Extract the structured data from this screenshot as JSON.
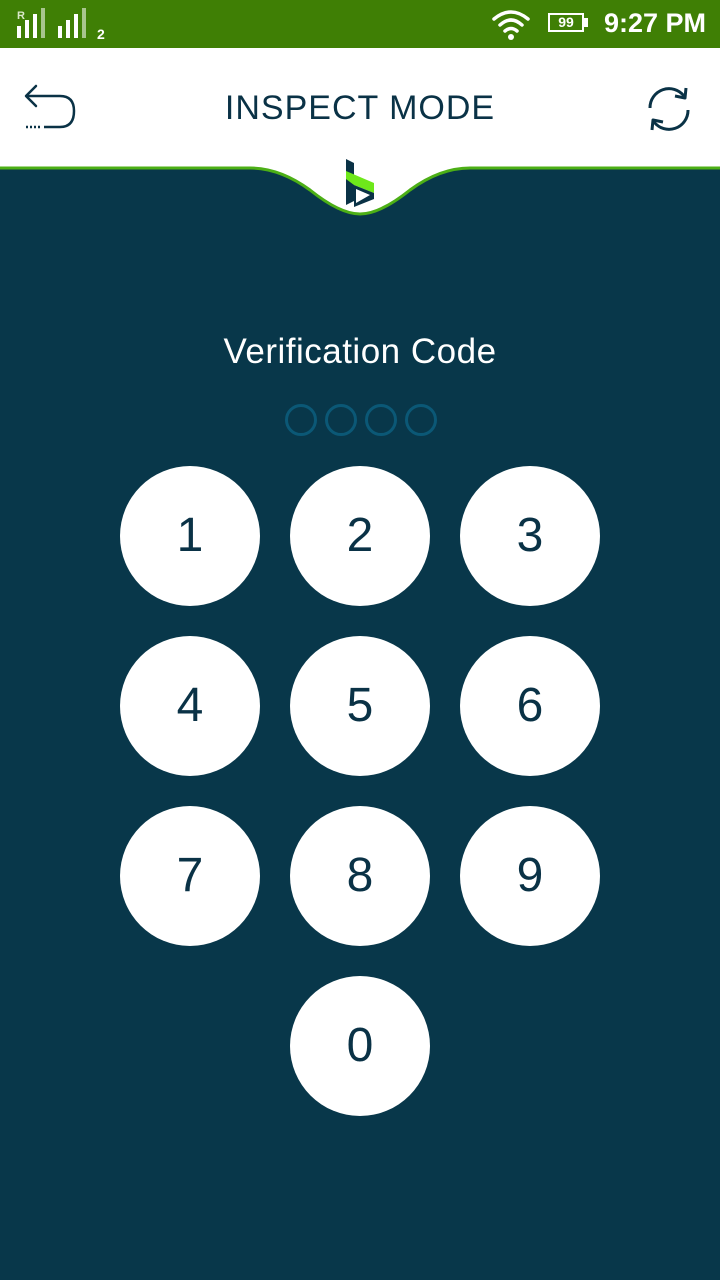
{
  "status_bar": {
    "sim1_label": "R",
    "sim2_label": "2",
    "battery": "99",
    "time": "9:27 PM"
  },
  "header": {
    "title": "INSPECT MODE",
    "back_icon": "back-arrow-icon",
    "refresh_icon": "refresh-icon",
    "logo_icon": "brand-logo-icon"
  },
  "verification": {
    "label": "Verification Code",
    "digits_entered": 0,
    "digits_total": 4
  },
  "keypad": {
    "k1": "1",
    "k2": "2",
    "k3": "3",
    "k4": "4",
    "k5": "5",
    "k6": "6",
    "k7": "7",
    "k8": "8",
    "k9": "9",
    "k0": "0"
  },
  "colors": {
    "status_bar": "#3f7f05",
    "background": "#08374a",
    "accent_green": "#4caf16",
    "text_dark": "#0a3246"
  }
}
